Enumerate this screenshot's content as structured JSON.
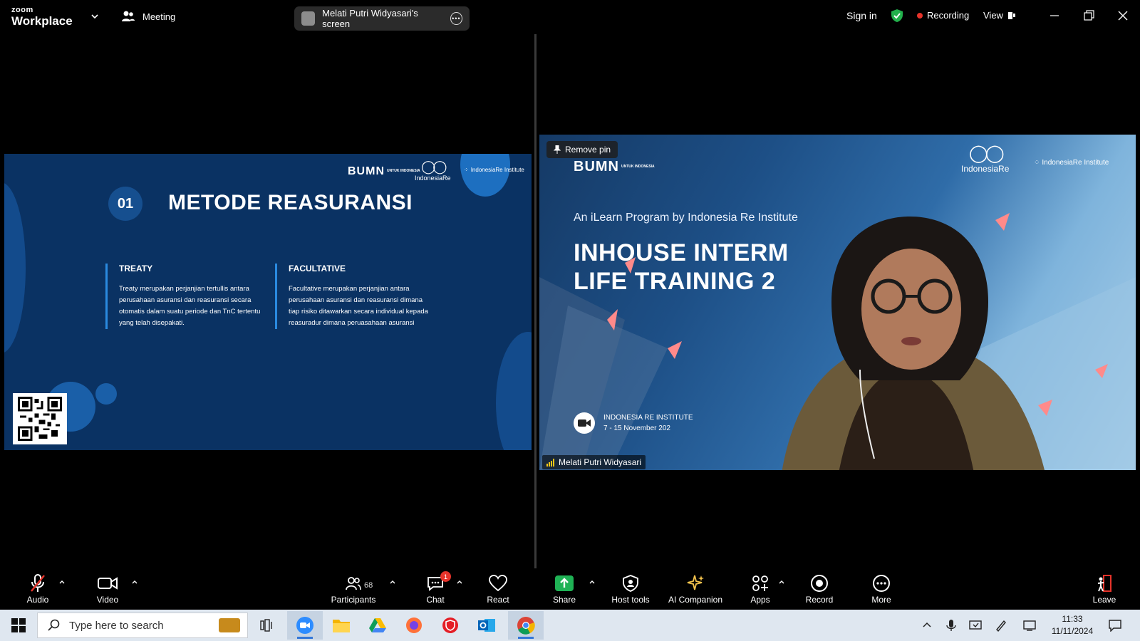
{
  "titlebar": {
    "brand_top": "zoom",
    "brand_bottom": "Workplace",
    "meeting_label": "Meeting",
    "screen_label": "Melati Putri Widyasari's screen",
    "sign_in": "Sign in",
    "recording": "Recording",
    "view": "View"
  },
  "slide": {
    "number": "01",
    "title": "METODE REASURANSI",
    "logo_bumn": "BUMN",
    "logo_bumn_sub": "UNTUK INDONESIA",
    "logo_ire": "IndonesiaRe",
    "logo_iri": "IndonesiaRe Institute",
    "treaty_heading": "TREATY",
    "treaty_text": "Treaty merupakan perjanjian tertullis antara perusahaan asuransi dan reasuransi secara otomatis dalam suatu periode dan TnC tertentu yang telah disepakati.",
    "facultative_heading": "FACULTATIVE",
    "facultative_text": "Facultative merupakan perjanjian antara perusahaan asuransi dan reasuransi dimana tiap risiko ditawarkan secara individual kepada reasuradur dimana peruasahaan asuransi"
  },
  "video": {
    "remove_pin": "Remove pin",
    "logo_bumn": "BUMN",
    "logo_bumn_sub": "UNTUK INDONESIA",
    "logo_ire": "IndonesiaRe",
    "logo_iri": "IndonesiaRe Institute",
    "subtitle": "An iLearn Program by Indonesia Re Institute",
    "title_line1": "INHOUSE INTERM",
    "title_line2": "LIFE TRAINING 2",
    "inst_name": "INDONESIA RE INSTITUTE",
    "inst_date": "7 - 15 November 202",
    "participant_name": "Melati Putri Widyasari"
  },
  "toolbar": {
    "audio": "Audio",
    "video": "Video",
    "participants": "Participants",
    "participants_count": "68",
    "chat": "Chat",
    "chat_badge": "1",
    "react": "React",
    "share": "Share",
    "host_tools": "Host tools",
    "ai_companion": "AI Companion",
    "apps": "Apps",
    "record": "Record",
    "more": "More",
    "leave": "Leave"
  },
  "taskbar": {
    "search_placeholder": "Type here to search",
    "time": "11:33",
    "date": "11/11/2024"
  },
  "colors": {
    "accent_blue": "#2a8ae0",
    "share_green": "#1fb255",
    "record_red": "#e6332a",
    "slide_bg": "#0a3263"
  }
}
